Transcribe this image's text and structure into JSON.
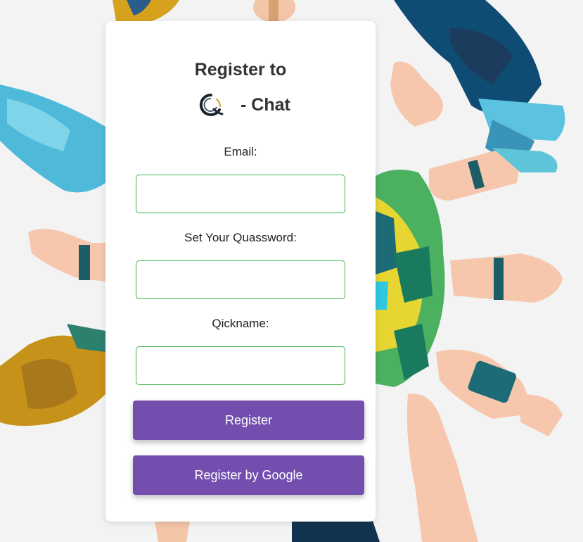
{
  "form": {
    "title": "Register to",
    "brand_suffix": "- Chat",
    "logo_icon": "chat-q-logo-icon",
    "email_label": "Email:",
    "email_value": "",
    "password_label": "Set Your Quassword:",
    "password_value": "",
    "nickname_label": "Qickname:",
    "nickname_value": "",
    "register_label": "Register",
    "google_label": "Register by Google"
  },
  "colors": {
    "accent": "#734eaf",
    "input_border": "#3bb54a",
    "page_background": "#f3f3f4"
  }
}
